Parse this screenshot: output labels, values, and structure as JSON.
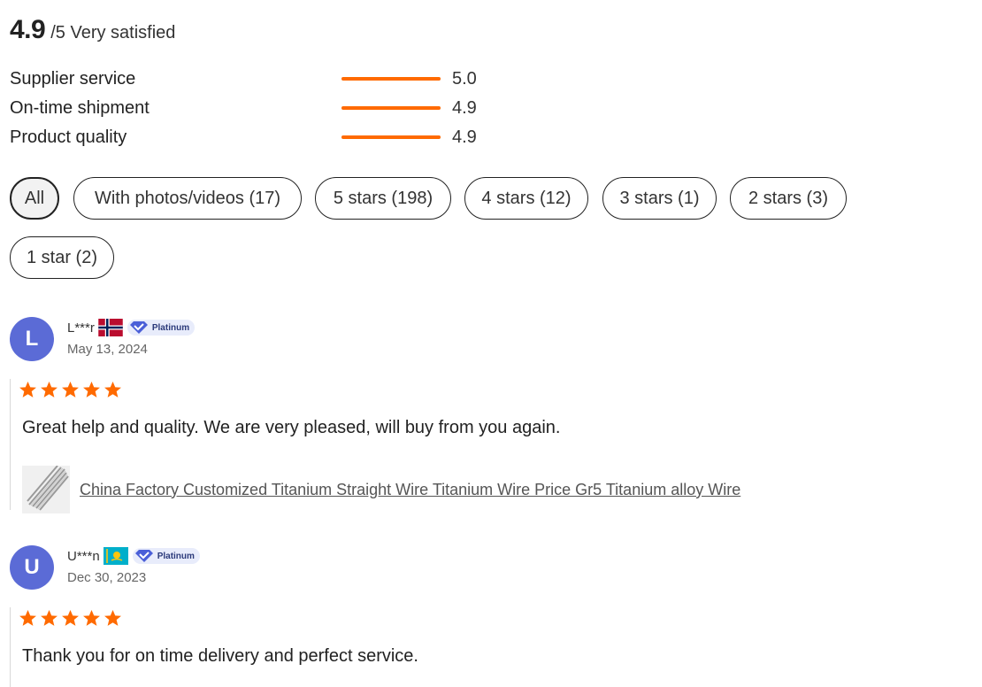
{
  "overall": {
    "score": "4.9",
    "out_of": "/5 Very satisfied"
  },
  "metrics": [
    {
      "label": "Supplier service",
      "value": "5.0",
      "fill": 1.0
    },
    {
      "label": "On-time shipment",
      "value": "4.9",
      "fill": 1.0
    },
    {
      "label": "Product quality",
      "value": "4.9",
      "fill": 1.0
    }
  ],
  "filters": [
    {
      "label": "All",
      "active": true
    },
    {
      "label": "With photos/videos (17)"
    },
    {
      "label": "5 stars (198)"
    },
    {
      "label": "4 stars (12)"
    },
    {
      "label": "3 stars (1)"
    },
    {
      "label": "2 stars (3)"
    },
    {
      "label": "1 star (2)"
    }
  ],
  "colors": {
    "accent": "#ff6a00",
    "avatar": "#5b6bd6",
    "badge_bg": "#e8ecfb",
    "badge_icon": "#4a5fd8"
  },
  "reviews": [
    {
      "initial": "L",
      "name": "L***r",
      "flag": "norway-flag",
      "badge": "Platinum",
      "date": "May 13, 2024",
      "stars": 5,
      "text": "Great help and quality. We are very pleased, will buy from you again.",
      "product_title": "China Factory Customized Titanium Straight Wire Titanium Wire Price Gr5 Titanium alloy Wire"
    },
    {
      "initial": "U",
      "name": "U***n",
      "flag": "kazakhstan-flag",
      "badge": "Platinum",
      "date": "Dec 30, 2023",
      "stars": 5,
      "text": "Thank you for on time delivery and perfect service."
    }
  ]
}
